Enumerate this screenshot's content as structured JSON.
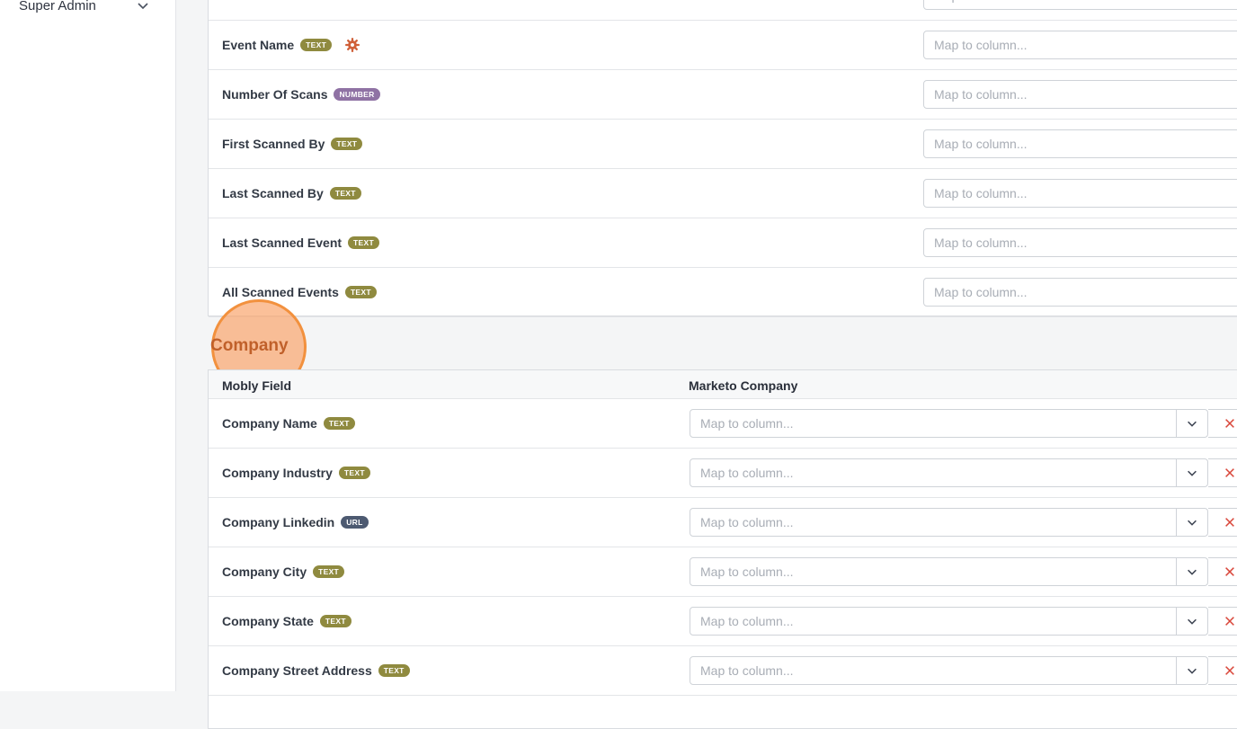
{
  "sidebar": {
    "user_role": "Super Admin"
  },
  "top_section": {
    "placeholder": "Map to column...",
    "rows": [
      {
        "name": "Event Name",
        "type": "TEXT",
        "type_class": "text",
        "has_gear": true
      },
      {
        "name": "Number Of Scans",
        "type": "NUMBER",
        "type_class": "number",
        "has_gear": false
      },
      {
        "name": "First Scanned By",
        "type": "TEXT",
        "type_class": "text",
        "has_gear": false
      },
      {
        "name": "Last Scanned By",
        "type": "TEXT",
        "type_class": "text",
        "has_gear": false
      },
      {
        "name": "Last Scanned Event",
        "type": "TEXT",
        "type_class": "text",
        "has_gear": false
      },
      {
        "name": "All Scanned Events",
        "type": "TEXT",
        "type_class": "text",
        "has_gear": false
      }
    ]
  },
  "company_section": {
    "title": "Company",
    "header": {
      "col1": "Mobly Field",
      "col2": "Marketo Company"
    },
    "placeholder": "Map to column...",
    "rows": [
      {
        "name": "Company Name",
        "type": "TEXT",
        "type_class": "text"
      },
      {
        "name": "Company Industry",
        "type": "TEXT",
        "type_class": "text"
      },
      {
        "name": "Company Linkedin",
        "type": "URL",
        "type_class": "url"
      },
      {
        "name": "Company City",
        "type": "TEXT",
        "type_class": "text"
      },
      {
        "name": "Company State",
        "type": "TEXT",
        "type_class": "text"
      },
      {
        "name": "Company Street Address",
        "type": "TEXT",
        "type_class": "text"
      }
    ]
  },
  "colors": {
    "badge_text": "#8f8a3f",
    "badge_number": "#8f72a4",
    "badge_url": "#4d5a71",
    "accent_orange": "#c0602a",
    "clear_red": "#d9463a"
  },
  "icons": {
    "sidebar_chevron": "chevron-down-icon",
    "gear": "gear-icon",
    "dropdown": "chevron-down-icon",
    "clear": "close-icon"
  }
}
